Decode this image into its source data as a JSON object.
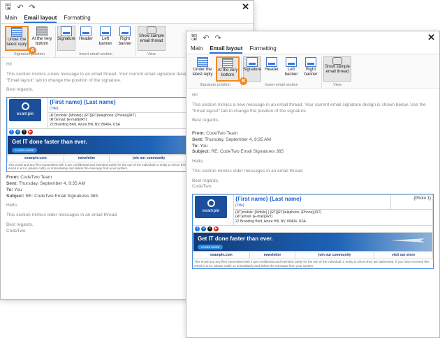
{
  "window1": {
    "tabs": [
      "Main",
      "Email layout",
      "Formatting"
    ],
    "ribbon": {
      "position_group": {
        "label": "Signature position",
        "btn1": "Under the latest reply",
        "btn2": "At the very bottom"
      },
      "insert_group": {
        "label": "Insert email section",
        "signature": "Signature",
        "header": "Header",
        "left": "Left banner",
        "right": "Right banner"
      },
      "view_group": {
        "label": "View",
        "sample": "Show sample email thread"
      }
    },
    "badge": "A",
    "greeting": "Hi!",
    "section_text": "This section mimics a new message in an email thread. Your current email signature design is shown below. Use the \"Email layout\" tab to change the position of the signature.",
    "regards": "Best regards,",
    "from_label": "From:",
    "from": "CodeTwo Team",
    "sent_label": "Sent:",
    "sent": "Thursday, September 4, 9:35 AM",
    "to_label": "To:",
    "to": "You",
    "subject_label": "Subject:",
    "subject": "RE: CodeTwo Email Signatures 365",
    "hello": "Hello,",
    "older_text": "This section mimics older messages in an email thread.",
    "regards2": "Best regards,",
    "company": "CodeTwo"
  },
  "window2": {
    "badge": "B"
  },
  "signature": {
    "name": "{First name} {Last name}",
    "title": "{Title}",
    "photo": "{Photo 1}",
    "contact": "{RT}mobile: {Mobile} | {RT}{RT}telephone: {Phone}{/RT}",
    "email": "{RT}email: {E-mail}{/RT}",
    "address": "22 Branding Blvd, Azure Hill, NV, 89404, USA",
    "logo_text": "example",
    "banner_text": "Get IT done faster than ever.",
    "banner_btn": "LEARN MORE",
    "links": [
      "example.com",
      "newsletter",
      "join our community",
      "visit our store"
    ],
    "disclaimer": "This email and any files transmitted with it are confidential and intended solely for the use of the individual or entity to whom they are addressed. If you have received this email in error, please notify us immediately and delete the message from your system.",
    "socials": [
      {
        "name": "facebook-icon",
        "glyph": "f",
        "color": "#1877f2"
      },
      {
        "name": "linkedin-icon",
        "glyph": "in",
        "color": "#0a66c2"
      },
      {
        "name": "x-icon",
        "glyph": "X",
        "color": "#111111"
      },
      {
        "name": "youtube-icon",
        "glyph": "▶",
        "color": "#e62117"
      }
    ]
  },
  "colors": {
    "accent": "#2c6fd6",
    "highlight": "#f08a24"
  }
}
